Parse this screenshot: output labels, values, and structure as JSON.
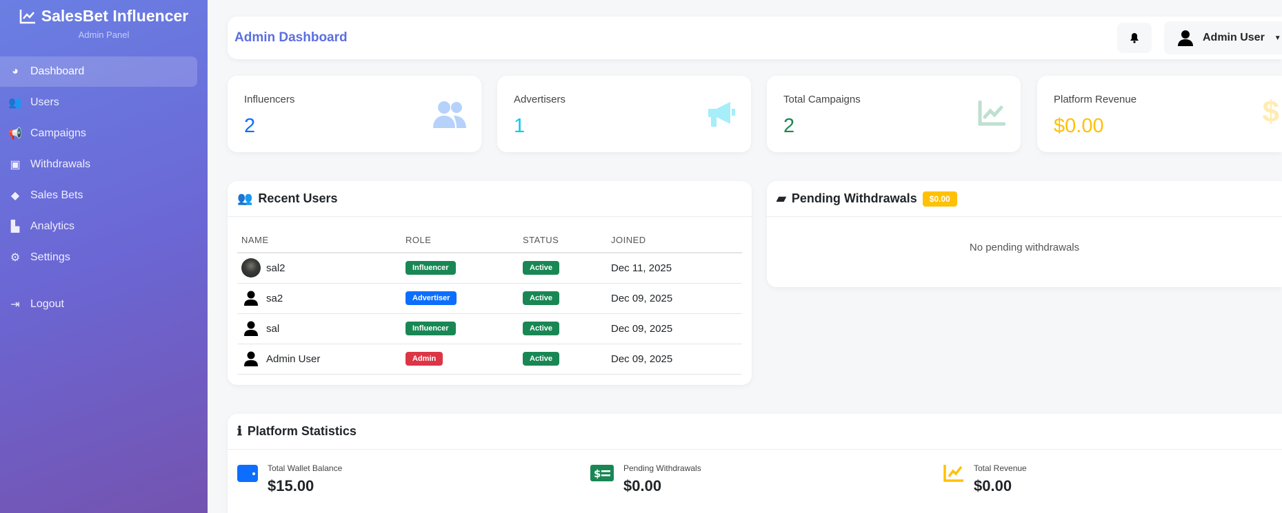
{
  "brand": {
    "title": "SalesBet Influencer",
    "subtitle": "Admin Panel"
  },
  "nav": [
    {
      "label": "Dashboard",
      "icon": "gauge-icon",
      "active": true
    },
    {
      "label": "Users",
      "icon": "users-icon"
    },
    {
      "label": "Campaigns",
      "icon": "bullhorn-icon"
    },
    {
      "label": "Withdrawals",
      "icon": "money-bill-icon"
    },
    {
      "label": "Sales Bets",
      "icon": "dice-icon"
    },
    {
      "label": "Analytics",
      "icon": "chart-bar-icon"
    },
    {
      "label": "Settings",
      "icon": "gear-icon"
    },
    {
      "label": "Logout",
      "icon": "sign-out-icon"
    }
  ],
  "header": {
    "title": "Admin Dashboard",
    "user": "Admin User"
  },
  "stats": [
    {
      "label": "Influencers",
      "value": "2",
      "color": "#0d6efd"
    },
    {
      "label": "Advertisers",
      "value": "1",
      "color": "#0dcaf0"
    },
    {
      "label": "Total Campaigns",
      "value": "2",
      "color": "#198754"
    },
    {
      "label": "Platform Revenue",
      "value": "$0.00",
      "color": "#ffc107"
    }
  ],
  "recent_users": {
    "title": "Recent Users",
    "columns": [
      "NAME",
      "ROLE",
      "STATUS",
      "JOINED"
    ],
    "rows": [
      {
        "name": "sal2",
        "role": "Influencer",
        "status": "Active",
        "joined": "Dec 11, 2025"
      },
      {
        "name": "sa2",
        "role": "Advertiser",
        "status": "Active",
        "joined": "Dec 09, 2025"
      },
      {
        "name": "sal",
        "role": "Influencer",
        "status": "Active",
        "joined": "Dec 09, 2025"
      },
      {
        "name": "Admin User",
        "role": "Admin",
        "status": "Active",
        "joined": "Dec 09, 2025"
      }
    ]
  },
  "pending": {
    "title": "Pending Withdrawals",
    "badge": "$0.00",
    "empty": "No pending withdrawals"
  },
  "platform": {
    "title": "Platform Statistics",
    "items": [
      {
        "label": "Total Wallet Balance",
        "value": "$15.00"
      },
      {
        "label": "Pending Withdrawals",
        "value": "$0.00"
      },
      {
        "label": "Total Revenue",
        "value": "$0.00"
      }
    ]
  }
}
